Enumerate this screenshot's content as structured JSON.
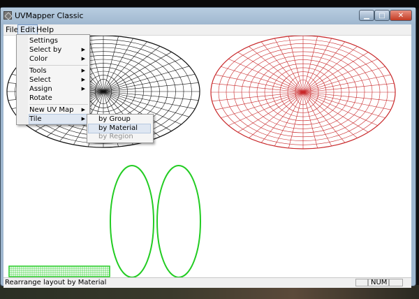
{
  "window": {
    "title": "UVMapper Classic"
  },
  "menubar": {
    "file": "File",
    "edit": "Edit",
    "help": "Help"
  },
  "edit_menu": {
    "items": [
      {
        "label": "Settings",
        "submenu": false
      },
      {
        "label": "Select by",
        "submenu": true
      },
      {
        "label": "Color",
        "submenu": true
      },
      {
        "label": "Tools",
        "submenu": true
      },
      {
        "label": "Select",
        "submenu": true
      },
      {
        "label": "Assign",
        "submenu": true
      },
      {
        "label": "Rotate",
        "submenu": false
      },
      {
        "label": "New UV Map",
        "submenu": true
      },
      {
        "label": "Tile",
        "submenu": true
      }
    ]
  },
  "tile_submenu": {
    "items": [
      {
        "label": "by Group",
        "enabled": true,
        "highlighted": false
      },
      {
        "label": "by Material",
        "enabled": true,
        "highlighted": true
      },
      {
        "label": "by Region",
        "enabled": false,
        "highlighted": false
      }
    ]
  },
  "status": {
    "text": "Rearrange layout by Material",
    "num": "NUM"
  },
  "colors": {
    "black_mesh": "#111111",
    "red_mesh": "#c8282a",
    "green_mesh": "#22cc22"
  }
}
